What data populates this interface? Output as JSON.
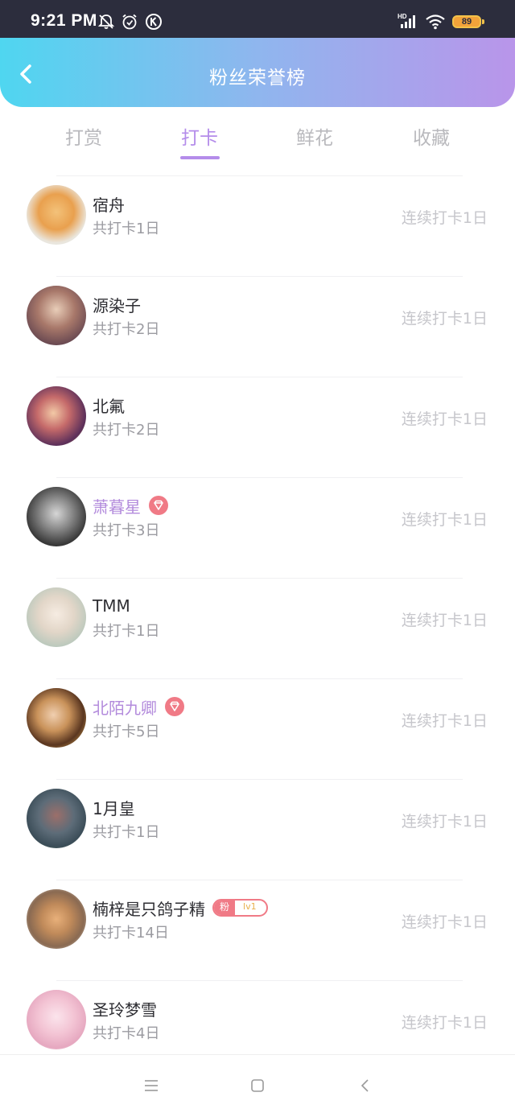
{
  "status_bar": {
    "time": "9:21 PM",
    "battery": "89"
  },
  "header": {
    "title": "粉丝荣誉榜"
  },
  "tabs": [
    {
      "label": "打赏"
    },
    {
      "label": "打卡"
    },
    {
      "label": "鲜花"
    },
    {
      "label": "收藏"
    }
  ],
  "active_tab": "打卡",
  "rows": [
    {
      "name": "宿舟",
      "total": "共打卡1日",
      "streak": "连续打卡1日"
    },
    {
      "name": "源染子",
      "total": "共打卡2日",
      "streak": "连续打卡1日"
    },
    {
      "name": "北氟",
      "total": "共打卡2日",
      "streak": "连续打卡1日"
    },
    {
      "name": "萧暮星",
      "total": "共打卡3日",
      "streak": "连续打卡1日",
      "vip": true
    },
    {
      "name": "TMM",
      "total": "共打卡1日",
      "streak": "连续打卡1日"
    },
    {
      "name": "北陌九卿",
      "total": "共打卡5日",
      "streak": "连续打卡1日",
      "vip": true
    },
    {
      "name": "1月皇",
      "total": "共打卡1日",
      "streak": "连续打卡1日"
    },
    {
      "name": "楠梓是只鸽子精",
      "total": "共打卡14日",
      "streak": "连续打卡1日",
      "fan_badge": {
        "label": "粉",
        "level": "lv1"
      }
    },
    {
      "name": "圣玲梦雪",
      "total": "共打卡4日",
      "streak": "连续打卡1日"
    }
  ],
  "colors": {
    "accent": "#b48cea",
    "vip_name": "#b38bdc",
    "badge": "#f07a86",
    "header_gradient_start": "#4fd6f0",
    "header_gradient_end": "#b995ea"
  }
}
